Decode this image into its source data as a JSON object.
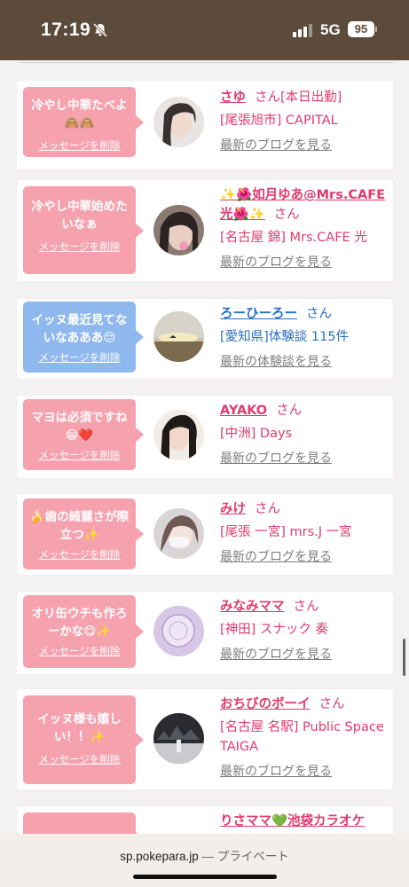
{
  "status_bar": {
    "time": "17:19",
    "network": "5G",
    "battery": "95",
    "silent_icon": "bell-slash-icon"
  },
  "cards": [
    {
      "message": "冷やし中華たべよ🙈🙈",
      "delete_label": "メッセージを削除",
      "bubble_color": "pink",
      "name": "さゆ",
      "name_extra": "",
      "san": "さん",
      "suffix": "[本日出勤]",
      "shop": "[尾張旭市] CAPITAL",
      "blog": "最新のブログを見る"
    },
    {
      "message": "冷やし中華始めたいなぁ",
      "delete_label": "メッセージを削除",
      "bubble_color": "pink",
      "name": "✨🌺如月ゆあ@Mrs.CAFE光🌺✨",
      "name_extra": "",
      "san": "さん",
      "suffix": "",
      "shop": "[名古屋 錦] Mrs.CAFE 光",
      "blog": "最新のブログを見る"
    },
    {
      "message": "イッヌ最近見てないなあああ😔",
      "delete_label": "メッセージを削除",
      "bubble_color": "blue",
      "name": "ろーひーろー",
      "name_extra": "",
      "san": "さん",
      "suffix": "",
      "shop": "[愛知県]体験談 115件",
      "blog": "最新の体験談を見る"
    },
    {
      "message": "マヨは必須ですね😁❤️",
      "delete_label": "メッセージを削除",
      "bubble_color": "pink",
      "name": "AYAKO",
      "name_extra": "",
      "san": "さん",
      "suffix": "",
      "shop": "[中洲] Days",
      "blog": "最新のブログを見る"
    },
    {
      "message": "🍌歯の綺麗さが際立つ✨",
      "delete_label": "メッセージを削除",
      "bubble_color": "pink",
      "name": "みけ",
      "name_extra": "",
      "san": "さん",
      "suffix": "",
      "shop": "[尾張 一宮] mrs.J 一宮",
      "blog": "最新のブログを見る"
    },
    {
      "message": "オリ缶ウチも作ろーかな😋✨",
      "delete_label": "メッセージを削除",
      "bubble_color": "pink",
      "name": "みなみママ",
      "name_extra": "",
      "san": "さん",
      "suffix": "",
      "shop": "[神田] スナック 奏",
      "blog": "最新のブログを見る"
    },
    {
      "message": "イッヌ様も嬉しい！！✨",
      "delete_label": "メッセージを削除",
      "bubble_color": "pink",
      "name": "おちびのボーイ",
      "name_extra": "",
      "san": "さん",
      "suffix": "",
      "shop": "[名古屋 名駅] Public Space TAIGA",
      "blog": "最新のブログを見る"
    },
    {
      "message": "",
      "delete_label": "",
      "bubble_color": "pink",
      "name": "りさママ💚池袋カラオケ",
      "name_extra": "",
      "san": "",
      "suffix": "",
      "shop": "",
      "blog": ""
    }
  ],
  "browser": {
    "url": "sp.pokepara.jp",
    "separator": " — ",
    "private_label": "プライベート"
  },
  "colors": {
    "status_bar": "#5c4b3b",
    "bubble_pink": "#f6a2ae",
    "bubble_blue": "#8fb8ef",
    "link_pink": "#e03a6e",
    "link_blue": "#2a6fbf"
  }
}
